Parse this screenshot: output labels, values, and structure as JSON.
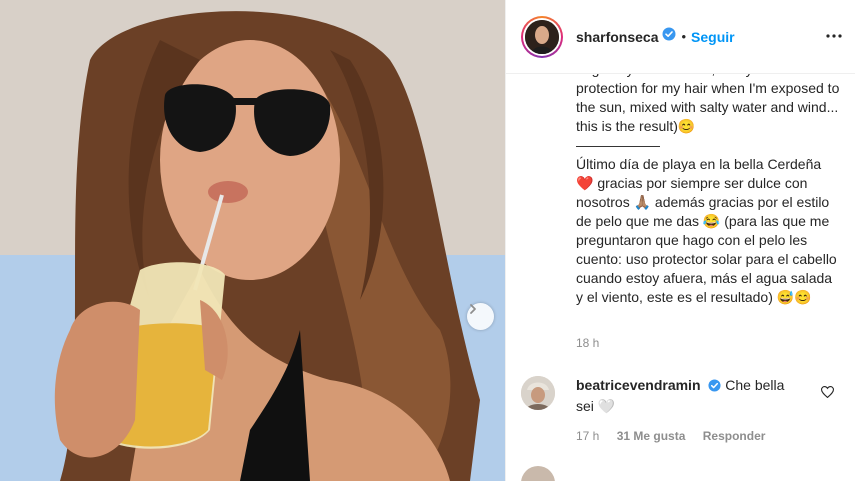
{
  "post": {
    "username": "sharfonseca",
    "separator": "•",
    "follow_label": "Seguir",
    "more_icon": "more-horizontal-icon",
    "caption_partial_top": "to get my hair like this, I only use sun",
    "caption_en": "protection for my hair when I'm exposed to the sun, mixed with salty water and wind... this is the result)😊",
    "caption_divider": "——————",
    "caption_es": "Último día de playa en la bella Cerdeña ❤️ gracias por siempre ser dulce con nosotros 🙏🏽 además gracias por el estilo de pelo que me das 😂 (para las que me preguntaron que hago con el pelo les cuento: uso protector solar para el cabello cuando estoy afuera, más el agua salada y el viento, este es el resultado) 😅😊",
    "time": "18 h"
  },
  "comments": [
    {
      "username": "beatricevendramin",
      "text": "Che bella sei 🤍",
      "time": "17 h",
      "likes": "31 Me gusta",
      "reply_label": "Responder"
    }
  ],
  "colors": {
    "accent": "#0095f6",
    "text": "#262626",
    "muted": "#8e8e8e",
    "verified": "#3897f0"
  }
}
